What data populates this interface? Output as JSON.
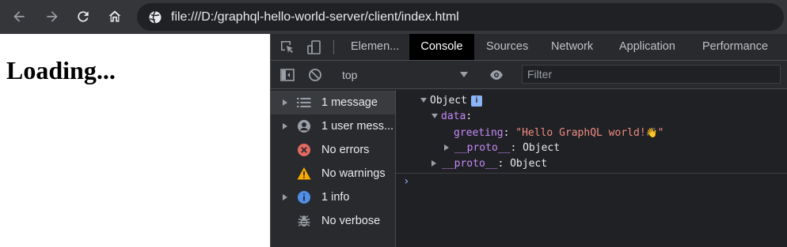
{
  "browser": {
    "url": "file:///D:/graphql-hello-world-server/client/index.html",
    "icons": {
      "back": "arrow-left-icon",
      "forward": "arrow-right-icon",
      "reload": "reload-icon",
      "home": "home-icon",
      "site": "globe-icon"
    }
  },
  "page": {
    "heading": "Loading..."
  },
  "devtools": {
    "tabs": [
      {
        "label": "Elemen..."
      },
      {
        "label": "Console"
      },
      {
        "label": "Sources"
      },
      {
        "label": "Network"
      },
      {
        "label": "Application"
      },
      {
        "label": "Performance"
      }
    ],
    "active_tab": "Console",
    "context_select": "top",
    "filter_placeholder": "Filter",
    "sidebar": [
      {
        "label": "1 message",
        "icon": "list-icon"
      },
      {
        "label": "1 user mess...",
        "icon": "user-icon"
      },
      {
        "label": "No errors",
        "icon": "error-icon"
      },
      {
        "label": "No warnings",
        "icon": "warning-icon"
      },
      {
        "label": "1 info",
        "icon": "info-icon"
      },
      {
        "label": "No verbose",
        "icon": "bug-icon"
      }
    ],
    "console": {
      "object_label": "Object",
      "info_badge": "i",
      "data_key": "data",
      "greeting_key": "greeting",
      "greeting_value": "Hello GraphQL world!",
      "proto_key": "__proto__",
      "proto_value": "Object",
      "prompt": "›"
    },
    "colors": {
      "active_tab_bg": "#000000",
      "panel_bg": "#202124",
      "string_red": "#f28b82",
      "key_purple": "#c58af9"
    }
  }
}
